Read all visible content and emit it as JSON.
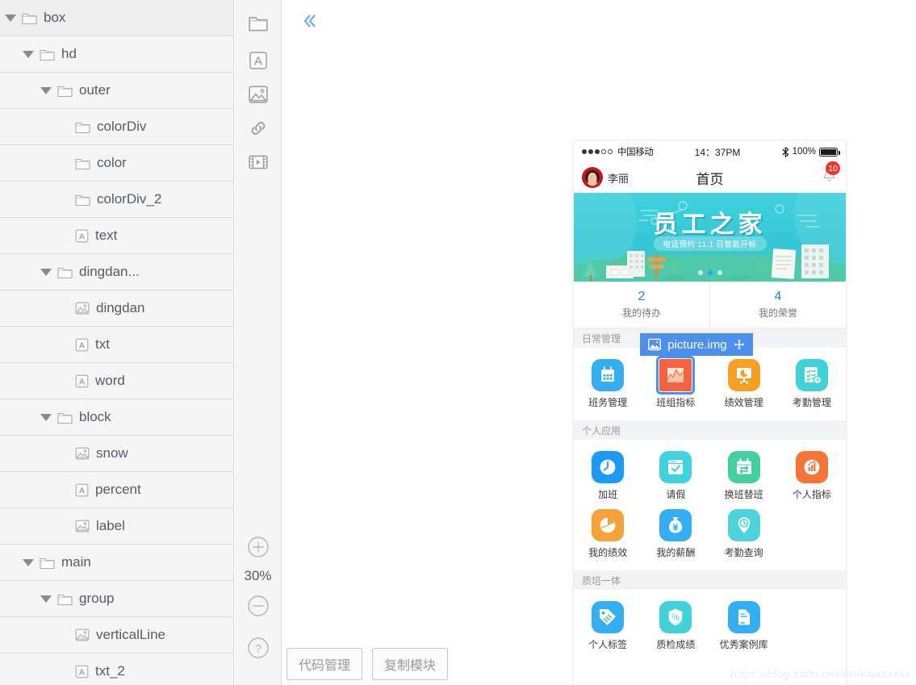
{
  "tree": {
    "nodes": [
      {
        "label": "box",
        "depth": 0,
        "type": "folder",
        "expanded": true
      },
      {
        "label": "hd",
        "depth": 1,
        "type": "folder",
        "expanded": true
      },
      {
        "label": "outer",
        "depth": 2,
        "type": "folder",
        "expanded": true
      },
      {
        "label": "colorDiv",
        "depth": 3,
        "type": "folder",
        "expanded": null
      },
      {
        "label": "color",
        "depth": 3,
        "type": "folder",
        "expanded": null
      },
      {
        "label": "colorDiv_2",
        "depth": 3,
        "type": "folder",
        "expanded": null
      },
      {
        "label": "text",
        "depth": 3,
        "type": "text",
        "expanded": null
      },
      {
        "label": "dingdan...",
        "depth": 2,
        "type": "folder",
        "expanded": true
      },
      {
        "label": "dingdan",
        "depth": 3,
        "type": "image",
        "expanded": null
      },
      {
        "label": "txt",
        "depth": 3,
        "type": "text",
        "expanded": null
      },
      {
        "label": "word",
        "depth": 3,
        "type": "text",
        "expanded": null
      },
      {
        "label": "block",
        "depth": 2,
        "type": "folder",
        "expanded": true
      },
      {
        "label": "snow",
        "depth": 3,
        "type": "image",
        "expanded": null
      },
      {
        "label": "percent",
        "depth": 3,
        "type": "text",
        "expanded": null
      },
      {
        "label": "label",
        "depth": 3,
        "type": "image",
        "expanded": null
      },
      {
        "label": "main",
        "depth": 1,
        "type": "folder",
        "expanded": true
      },
      {
        "label": "group",
        "depth": 2,
        "type": "folder",
        "expanded": true
      },
      {
        "label": "verticalLine",
        "depth": 3,
        "type": "image",
        "expanded": null
      },
      {
        "label": "txt_2",
        "depth": 3,
        "type": "text",
        "expanded": null
      }
    ]
  },
  "toolstrip": {
    "tools": [
      {
        "icon": "folder-icon",
        "name": "folder-tool"
      },
      {
        "icon": "text-icon",
        "name": "text-tool"
      },
      {
        "icon": "image-icon",
        "name": "image-tool"
      },
      {
        "icon": "link-icon",
        "name": "link-tool"
      },
      {
        "icon": "video-icon",
        "name": "video-tool"
      }
    ],
    "zoom_in_icon": "plus-circle-icon",
    "zoom_level": "30%",
    "zoom_out_icon": "minus-circle-icon",
    "help_icon": "question-circle-icon"
  },
  "canvas": {
    "collapse_icon": "double-chevron-left-icon",
    "watermark": "https://blog.csdn.net/weikaixxxxxx"
  },
  "bottom_bar": {
    "buttons": [
      {
        "label": "代码管理",
        "name": "code-manage-button"
      },
      {
        "label": "复制模块",
        "name": "copy-module-button"
      }
    ]
  },
  "phone": {
    "statusbar": {
      "signal_dots": [
        true,
        true,
        true,
        false,
        false
      ],
      "carrier": "中国移动",
      "time": "14：37PM",
      "bluetooth_icon": "bluetooth-icon",
      "battery_percent": "100%"
    },
    "navbar": {
      "avatar": "user-avatar",
      "username": "李丽",
      "title": "首页",
      "bell_icon": "bell-icon",
      "bell_badge": "10"
    },
    "banner": {
      "title": "员工之家",
      "subtitle": "电话预约 11.1 日智能开标",
      "dots_count": 3,
      "active_dot": 1
    },
    "stats": [
      {
        "value": "2",
        "label": "我的待办"
      },
      {
        "value": "4",
        "label": "我的荣誉"
      }
    ],
    "sections": [
      {
        "title": "日常管理",
        "rows": [
          [
            {
              "label": "班务管理",
              "icon": "calendar-icon",
              "color": "#33aef2",
              "selected": false
            },
            {
              "label": "班组指标",
              "icon": "chart-area-icon",
              "color": "#f4623f",
              "selected": true
            },
            {
              "label": "绩效管理",
              "icon": "pie-board-icon",
              "color": "#f6a023",
              "selected": false
            },
            {
              "label": "考勤管理",
              "icon": "checklist-clock-icon",
              "color": "#3fd2d8",
              "selected": false
            }
          ]
        ]
      },
      {
        "title": "个人应用",
        "rows": [
          [
            {
              "label": "加班",
              "icon": "clock-icon",
              "color": "#1b9af7",
              "selected": false
            },
            {
              "label": "请假",
              "icon": "check-window-icon",
              "color": "#3fd2e0",
              "selected": false
            },
            {
              "label": "换班替班",
              "icon": "swap-calendar-icon",
              "color": "#44cfa1",
              "selected": false
            },
            {
              "label": "个人指标",
              "icon": "bar-chart-icon",
              "color": "#f57536",
              "selected": false
            }
          ],
          [
            {
              "label": "我的绩效",
              "icon": "pie-chart-icon",
              "color": "#f5a23b",
              "selected": false
            },
            {
              "label": "我的薪酬",
              "icon": "money-bag-icon",
              "color": "#33aef2",
              "selected": false
            },
            {
              "label": "考勤查询",
              "icon": "pin-clock-icon",
              "color": "#4dd2de",
              "selected": false
            }
          ]
        ]
      },
      {
        "title": "质培一体",
        "rows": [
          [
            {
              "label": "个人标签",
              "icon": "tag-icon",
              "color": "#33aef2",
              "selected": false
            },
            {
              "label": "质检成绩",
              "icon": "shield-percent-icon",
              "color": "#3fd2d8",
              "selected": false
            },
            {
              "label": "优秀案例库",
              "icon": "document-icon",
              "color": "#33aef2",
              "selected": false
            }
          ]
        ]
      }
    ],
    "selection": {
      "icon": "image-icon",
      "name": "picture.img",
      "move_icon": "move-arrows-icon"
    }
  }
}
